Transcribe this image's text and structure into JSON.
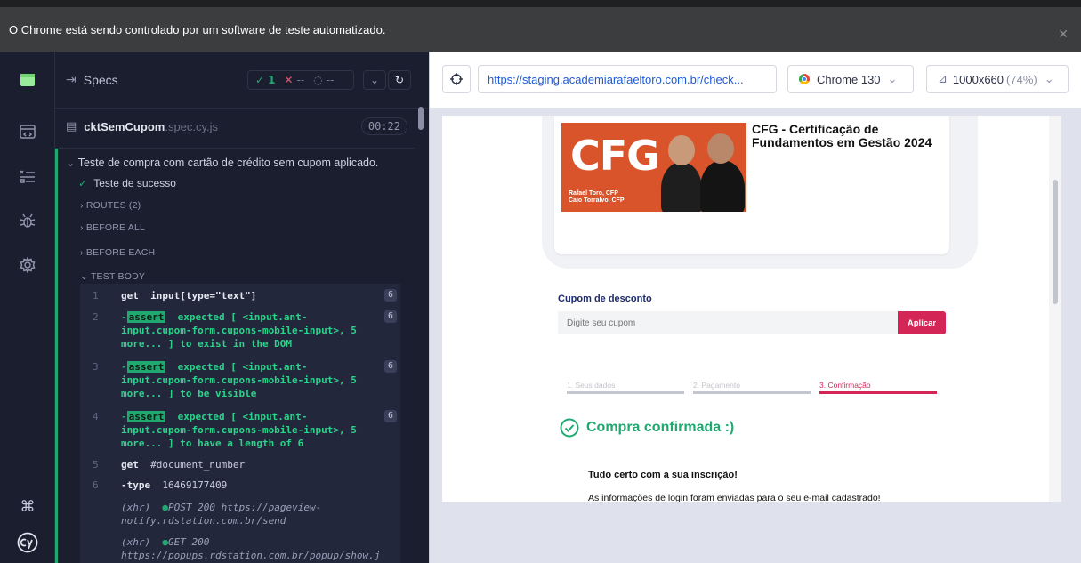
{
  "chrome_banner": {
    "text": "O Chrome está sendo controlado por um software de teste automatizado."
  },
  "specs": {
    "title": "Specs",
    "stats": {
      "passed": "1",
      "failed": "--",
      "pending": "--"
    },
    "file": {
      "name": "cktSemCupom",
      "ext": ".spec.cy.js",
      "duration": "00:22"
    },
    "suite": "Teste de compra com cartão de crédito sem cupom aplicado.",
    "test": "Teste de sucesso",
    "hooks": {
      "routes": "ROUTES (2)",
      "before_all": "BEFORE ALL",
      "before_each": "BEFORE EACH",
      "test_body": "TEST BODY"
    },
    "commands": [
      {
        "num": "1",
        "name": "get",
        "msg": "input[type=\"text\"]",
        "count": "6"
      },
      {
        "num": "2",
        "prefix": "-",
        "tag": "assert",
        "msg": "expected [ <input.ant-input.cupom-form.cupons-mobile-input>, 5 more... ] to exist in the DOM",
        "count": "6"
      },
      {
        "num": "3",
        "prefix": "-",
        "tag": "assert",
        "msg": "expected [ <input.ant-input.cupom-form.cupons-mobile-input>, 5 more... ] to be visible",
        "count": "6"
      },
      {
        "num": "4",
        "prefix": "-",
        "tag": "assert",
        "msg": "expected [ <input.ant-input.cupom-form.cupons-mobile-input>, 5 more... ] to have a length of 6",
        "count": "6"
      },
      {
        "num": "5",
        "name": "get",
        "msg": "#document_number"
      },
      {
        "num": "6",
        "name": "-type",
        "msg": "16469177409"
      }
    ],
    "xhrs": [
      {
        "label": "(xhr)",
        "msg": "POST 200 https://pageview-notify.rdstation.com.br/send"
      },
      {
        "label": "(xhr)",
        "msg": "GET 200 https://popups.rdstation.com.br/popup/show.j"
      }
    ]
  },
  "aut": {
    "url": "https://staging.academiarafaeltoro.com.br/check...",
    "browser": "Chrome 130",
    "viewport": "1000x660",
    "zoom": "(74%)"
  },
  "page": {
    "banner": {
      "big": "CFG",
      "names": [
        "Rafael Toro, CFP",
        "Caio Torralvo, CFP"
      ]
    },
    "product_title": "CFG - Certificação de Fundamentos em Gestão 2024",
    "coupon": {
      "label": "Cupom de desconto",
      "placeholder": "Digite seu cupom",
      "button": "Aplicar"
    },
    "steps": [
      "1. Seus dados",
      "2. Pagamento",
      "3. Confirmação"
    ],
    "confirmed": "Compra confirmada :)",
    "ok_title": "Tudo certo com a sua inscrição!",
    "ok_info": "As informações de login foram enviadas para o seu e-mail cadastrado!"
  },
  "colors": {
    "pass": "#1fa971",
    "fail": "#e45770",
    "accent": "#d42557",
    "link": "#1e5bd6"
  }
}
